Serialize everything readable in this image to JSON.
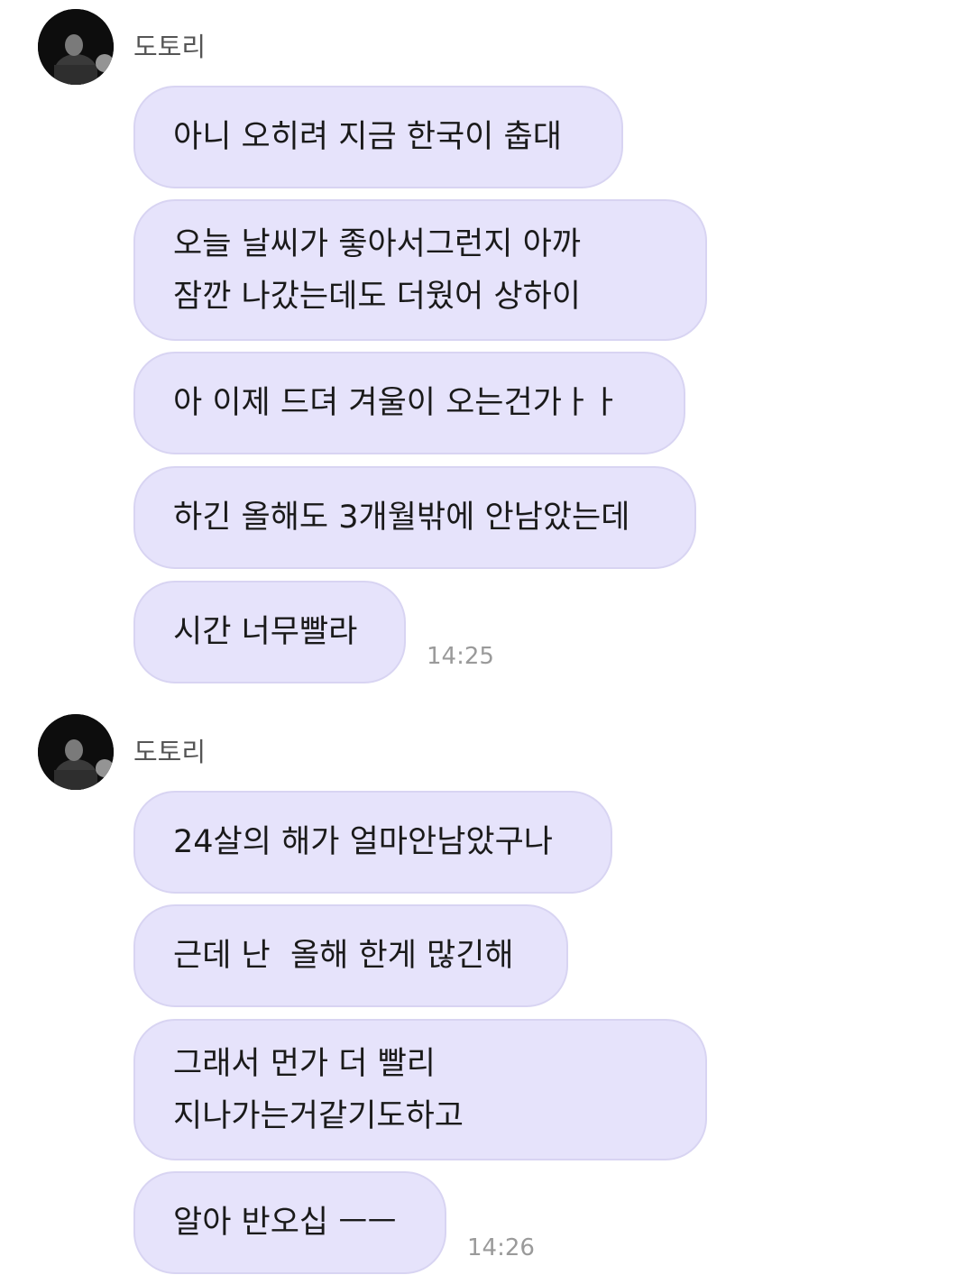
{
  "groups": [
    {
      "sender": "도토리",
      "messages": [
        [
          "아니 오히려 지금 한국이 춥대"
        ],
        [
          "오늘 날씨가 좋아서그런지 아까",
          "잠깐 나갔는데도 더웠어 상하이"
        ],
        [
          "아 이제 드뎌 겨울이 오는건가ㅏㅏ"
        ],
        [
          "하긴 올해도 3개월밖에 안남았는데"
        ],
        [
          "시간 너무빨라"
        ]
      ],
      "time": "14:25"
    },
    {
      "sender": "도토리",
      "messages": [
        [
          "24살의 해가 얼마안남았구나"
        ],
        [
          "근데 난  올해 한게 많긴해"
        ],
        [
          "그래서 먼가 더 빨리",
          "지나가는거같기도하고"
        ],
        [
          "알아 반오십 ㅡㅡ"
        ]
      ],
      "time": "14:26"
    }
  ],
  "colors": {
    "bubble": "#e6e3fb",
    "bubble_border": "#d8d4f2",
    "text": "#1a1a1a",
    "sender": "#555555",
    "time": "#9a9a9a",
    "avatar_bg": "#0d0d0d"
  },
  "icons": {
    "avatar": "profile-photo"
  }
}
